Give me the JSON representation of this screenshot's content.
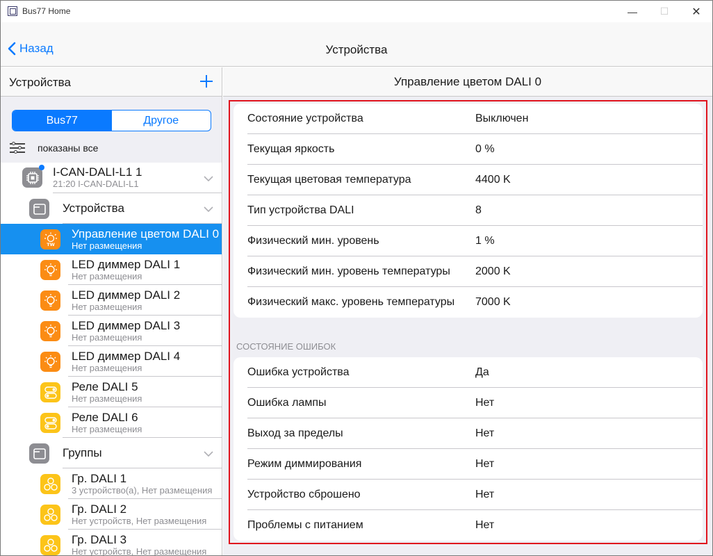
{
  "window": {
    "title": "Bus77 Home"
  },
  "nav": {
    "back_label": "Назад",
    "title": "Устройства"
  },
  "left": {
    "title": "Устройства",
    "segments": [
      "Bus77",
      "Другое"
    ],
    "filter_label": "показаны все",
    "gateway": {
      "name": "I-CAN-DALI-L1 1",
      "sub": "21:20 I-CAN-DALI-L1"
    },
    "devices_group": "Устройства",
    "devices": [
      {
        "name": "Управление цветом DALI 0",
        "sub": "Нет размещения",
        "icon": "tw-bulb-icon",
        "selected": true
      },
      {
        "name": "LED диммер DALI 1",
        "sub": "Нет размещения",
        "icon": "bulb-icon"
      },
      {
        "name": "LED диммер DALI 2",
        "sub": "Нет размещения",
        "icon": "bulb-icon"
      },
      {
        "name": "LED диммер DALI 3",
        "sub": "Нет размещения",
        "icon": "bulb-icon"
      },
      {
        "name": "LED диммер DALI 4",
        "sub": "Нет размещения",
        "icon": "bulb-icon"
      },
      {
        "name": "Реле DALI 5",
        "sub": "Нет размещения",
        "icon": "relay-icon"
      },
      {
        "name": "Реле DALI 6",
        "sub": "Нет размещения",
        "icon": "relay-icon"
      }
    ],
    "groups_group": "Группы",
    "groups": [
      {
        "name": "Гр. DALI 1",
        "sub": "3 устройство(а), Нет размещения",
        "icon": "group-icon"
      },
      {
        "name": "Гр. DALI 2",
        "sub": "Нет устройств, Нет размещения",
        "icon": "group-icon"
      },
      {
        "name": "Гр. DALI 3",
        "sub": "Нет устройств, Нет размещения",
        "icon": "group-icon"
      }
    ],
    "tw_label": "TW"
  },
  "detail": {
    "title": "Управление цветом DALI 0",
    "properties": [
      {
        "label": "Состояние устройства",
        "value": "Выключен"
      },
      {
        "label": "Текущая яркость",
        "value": "0 %"
      },
      {
        "label": "Текущая цветовая температура",
        "value": "4400 K"
      },
      {
        "label": "Тип устройства DALI",
        "value": "8"
      },
      {
        "label": "Физический мин. уровень",
        "value": "1 %"
      },
      {
        "label": "Физический мин. уровень температуры",
        "value": "2000 K"
      },
      {
        "label": "Физический макс. уровень температуры",
        "value": "7000 K"
      }
    ],
    "errors_title": "СОСТОЯНИЕ ОШИБОК",
    "errors": [
      {
        "label": "Ошибка устройства",
        "value": "Да"
      },
      {
        "label": "Ошибка лампы",
        "value": "Нет"
      },
      {
        "label": "Выход за пределы",
        "value": "Нет"
      },
      {
        "label": "Режим диммирования",
        "value": "Нет"
      },
      {
        "label": "Устройство сброшено",
        "value": "Нет"
      },
      {
        "label": "Проблемы с питанием",
        "value": "Нет"
      }
    ]
  },
  "colors": {
    "accent": "#0a7aff",
    "selected": "#1690f0",
    "highlight": "#e0141e",
    "orange": "#fb8c14",
    "yellow": "#fcc419"
  }
}
